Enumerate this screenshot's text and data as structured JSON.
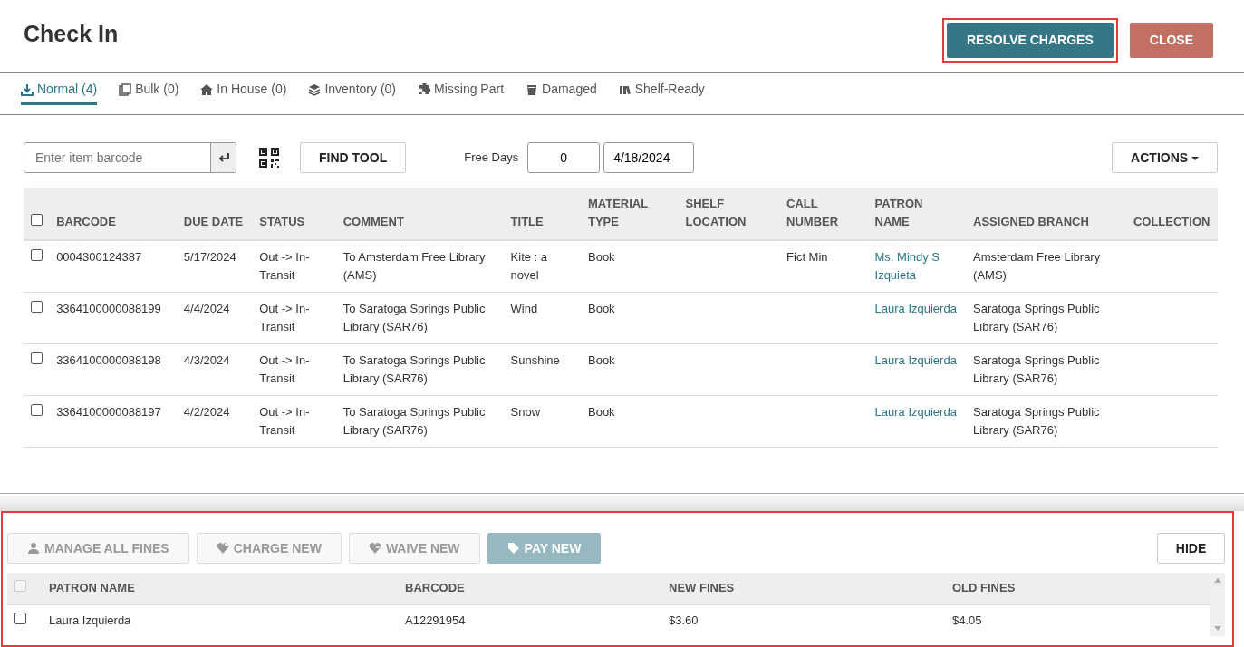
{
  "header": {
    "title": "Check In",
    "buttons": [
      {
        "label": "RESOLVE CHARGES",
        "kind": "primary",
        "highlighted": true
      },
      {
        "label": "CLOSE",
        "kind": "danger",
        "highlighted": false
      }
    ]
  },
  "tabs": [
    {
      "label": "Normal (4)",
      "selected": true
    },
    {
      "label": "Bulk (0)",
      "selected": false
    },
    {
      "label": "In House (0)",
      "selected": false
    },
    {
      "label": "Inventory (0)",
      "selected": false
    },
    {
      "label": "Missing Part",
      "selected": false
    },
    {
      "label": "Damaged",
      "selected": false
    },
    {
      "label": "Shelf-Ready",
      "selected": false
    }
  ],
  "toolbar": {
    "barcode_placeholder": "Enter item barcode",
    "find_tool": "FIND TOOL",
    "free_days_label": "Free Days",
    "free_days": "0",
    "date": "4/18/2024",
    "actions": "ACTIONS"
  },
  "items_table": {
    "select_all_checked": false,
    "columns": [
      "BARCODE",
      "DUE DATE",
      "STATUS",
      "COMMENT",
      "TITLE",
      "MATERIAL TYPE",
      "SHELF LOCATION",
      "CALL NUMBER",
      "PATRON NAME",
      "ASSIGNED BRANCH",
      "COLLECTION"
    ],
    "rows": [
      {
        "checked": false,
        "cells": [
          "0004300124387",
          "5/17/2024",
          "Out -> In-Transit",
          "To Amsterdam Free Library (AMS)",
          "Kite : a novel",
          "Book",
          "",
          "Fict Min",
          "Ms. Mindy S Izquieta",
          "Amsterdam Free Library (AMS)",
          ""
        ]
      },
      {
        "checked": false,
        "cells": [
          "3364100000088199",
          "4/4/2024",
          "Out -> In-Transit",
          "To Saratoga Springs Public Library (SAR76)",
          "Wind",
          "Book",
          "",
          "",
          "Laura Izquierda",
          "Saratoga Springs Public Library (SAR76)",
          ""
        ]
      },
      {
        "checked": false,
        "cells": [
          "3364100000088198",
          "4/3/2024",
          "Out -> In-Transit",
          "To Saratoga Springs Public Library (SAR76)",
          "Sunshine",
          "Book",
          "",
          "",
          "Laura Izquierda",
          "Saratoga Springs Public Library (SAR76)",
          ""
        ]
      },
      {
        "checked": false,
        "cells": [
          "3364100000088197",
          "4/2/2024",
          "Out -> In-Transit",
          "To Saratoga Springs Public Library (SAR76)",
          "Snow",
          "Book",
          "",
          "",
          "Laura Izquierda",
          "Saratoga Springs Public Library (SAR76)",
          ""
        ]
      }
    ]
  },
  "fines_panel": {
    "highlighted": true,
    "buttons": [
      {
        "label": "MANAGE ALL FINES",
        "disabled": true
      },
      {
        "label": "CHARGE NEW",
        "disabled": true
      },
      {
        "label": "WAIVE NEW",
        "disabled": true
      },
      {
        "label": "PAY NEW",
        "disabled": false
      }
    ],
    "select_all": {
      "checked": false,
      "disabled": true
    },
    "hide": "HIDE",
    "columns": [
      "PATRON NAME",
      "BARCODE",
      "NEW FINES",
      "OLD FINES"
    ],
    "rows": [
      {
        "checked": false,
        "cells": [
          "Laura Izquierda",
          "A12291954",
          "$3.60",
          "$4.05"
        ]
      }
    ]
  }
}
